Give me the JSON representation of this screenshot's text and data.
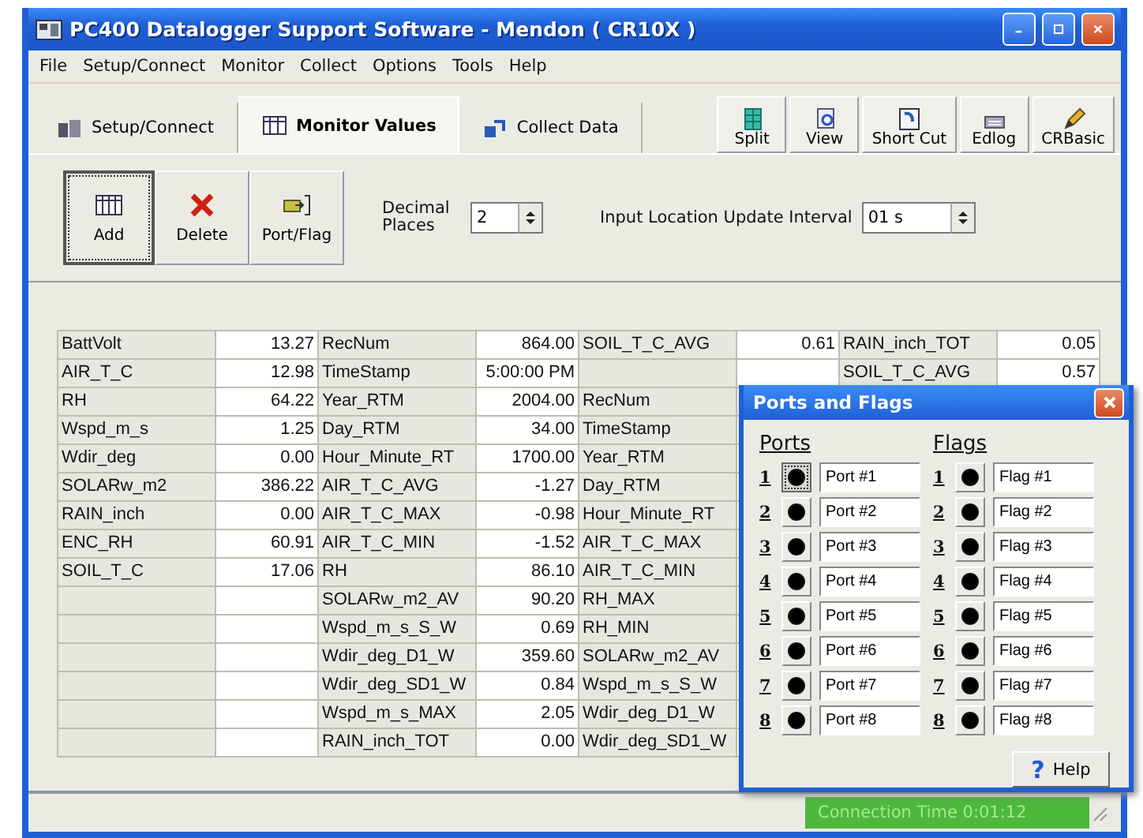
{
  "window": {
    "title": "PC400 Datalogger Support Software - Mendon ( CR10X )"
  },
  "menu": [
    {
      "label": "File"
    },
    {
      "label": "Setup/Connect"
    },
    {
      "label": "Monitor"
    },
    {
      "label": "Collect"
    },
    {
      "label": "Options"
    },
    {
      "label": "Tools"
    },
    {
      "label": "Help"
    }
  ],
  "tabs": [
    {
      "label": "Setup/Connect",
      "selected": false
    },
    {
      "label": "Monitor Values",
      "selected": true
    },
    {
      "label": "Collect Data",
      "selected": false
    }
  ],
  "tools": [
    {
      "label": "Split"
    },
    {
      "label": "View"
    },
    {
      "label": "Short Cut"
    },
    {
      "label": "Edlog"
    },
    {
      "label": "CRBasic"
    }
  ],
  "toolbar": {
    "buttons": [
      {
        "label": "Add",
        "selected": true
      },
      {
        "label": "Delete",
        "selected": false
      },
      {
        "label": "Port/Flag",
        "selected": false
      }
    ],
    "decimal_label": "Decimal Places",
    "decimal_value": "2",
    "interval_label": "Input Location Update Interval",
    "interval_value": "01 s"
  },
  "table": {
    "rows": [
      {
        "pairs": [
          {
            "name": "BattVolt",
            "value": "13.27"
          },
          {
            "name": "RecNum",
            "value": "864.00"
          },
          {
            "name": "SOIL_T_C_AVG",
            "value": "0.61"
          },
          {
            "name": "RAIN_inch_TOT",
            "value": "0.05"
          }
        ]
      },
      {
        "pairs": [
          {
            "name": "AIR_T_C",
            "value": "12.98"
          },
          {
            "name": "TimeStamp",
            "value": "5:00:00 PM"
          },
          {
            "blank": true
          },
          {
            "name": "SOIL_T_C_AVG",
            "value": "0.57"
          }
        ]
      },
      {
        "pairs": [
          {
            "name": "RH",
            "value": "64.22"
          },
          {
            "name": "Year_RTM",
            "value": "2004.00"
          },
          {
            "name": "RecNum"
          }
        ]
      },
      {
        "pairs": [
          {
            "name": "Wspd_m_s",
            "value": "1.25"
          },
          {
            "name": "Day_RTM",
            "value": "34.00"
          },
          {
            "name": "TimeStamp"
          }
        ]
      },
      {
        "pairs": [
          {
            "name": "Wdir_deg",
            "value": "0.00"
          },
          {
            "name": "Hour_Minute_RT",
            "value": "1700.00"
          },
          {
            "name": "Year_RTM"
          }
        ]
      },
      {
        "pairs": [
          {
            "name": "SOLARw_m2",
            "value": "386.22"
          },
          {
            "name": "AIR_T_C_AVG",
            "value": "-1.27"
          },
          {
            "name": "Day_RTM"
          }
        ]
      },
      {
        "pairs": [
          {
            "name": "RAIN_inch",
            "value": "0.00"
          },
          {
            "name": "AIR_T_C_MAX",
            "value": "-0.98"
          },
          {
            "name": "Hour_Minute_RT"
          }
        ]
      },
      {
        "pairs": [
          {
            "name": "ENC_RH",
            "value": "60.91"
          },
          {
            "name": "AIR_T_C_MIN",
            "value": "-1.52"
          },
          {
            "name": "AIR_T_C_MAX"
          }
        ]
      },
      {
        "pairs": [
          {
            "name": "SOIL_T_C",
            "value": "17.06"
          },
          {
            "name": "RH",
            "value": "86.10"
          },
          {
            "name": "AIR_T_C_MIN"
          }
        ]
      },
      {
        "pairs": [
          {
            "blank": true
          },
          {
            "name": "SOLARw_m2_AV",
            "value": "90.20"
          },
          {
            "name": "RH_MAX"
          }
        ]
      },
      {
        "pairs": [
          {
            "blank": true
          },
          {
            "name": "Wspd_m_s_S_W",
            "value": "0.69"
          },
          {
            "name": "RH_MIN"
          }
        ]
      },
      {
        "pairs": [
          {
            "blank": true
          },
          {
            "name": "Wdir_deg_D1_W",
            "value": "359.60"
          },
          {
            "name": "SOLARw_m2_AV"
          }
        ]
      },
      {
        "pairs": [
          {
            "blank": true
          },
          {
            "name": "Wdir_deg_SD1_W",
            "value": "0.84"
          },
          {
            "name": "Wspd_m_s_S_W"
          }
        ]
      },
      {
        "pairs": [
          {
            "blank": true
          },
          {
            "name": "Wspd_m_s_MAX",
            "value": "2.05"
          },
          {
            "name": "Wdir_deg_D1_W"
          }
        ]
      },
      {
        "pairs": [
          {
            "blank": true
          },
          {
            "name": "RAIN_inch_TOT",
            "value": "0.00"
          },
          {
            "name": "Wdir_deg_SD1_W"
          }
        ]
      }
    ]
  },
  "dialog": {
    "title": "Ports and Flags",
    "ports_heading": "Ports",
    "flags_heading": "Flags",
    "ports": [
      {
        "number": "1",
        "selected": true,
        "label": "Port #1"
      },
      {
        "number": "2",
        "selected": false,
        "label": "Port #2"
      },
      {
        "number": "3",
        "selected": false,
        "label": "Port #3"
      },
      {
        "number": "4",
        "selected": false,
        "label": "Port #4"
      },
      {
        "number": "5",
        "selected": false,
        "label": "Port #5"
      },
      {
        "number": "6",
        "selected": false,
        "label": "Port #6"
      },
      {
        "number": "7",
        "selected": false,
        "label": "Port #7"
      },
      {
        "number": "8",
        "selected": false,
        "label": "Port #8"
      }
    ],
    "flags": [
      {
        "number": "1",
        "selected": false,
        "label": "Flag #1"
      },
      {
        "number": "2",
        "selected": false,
        "label": "Flag #2"
      },
      {
        "number": "3",
        "selected": false,
        "label": "Flag #3"
      },
      {
        "number": "4",
        "selected": false,
        "label": "Flag #4"
      },
      {
        "number": "5",
        "selected": false,
        "label": "Flag #5"
      },
      {
        "number": "6",
        "selected": false,
        "label": "Flag #6"
      },
      {
        "number": "7",
        "selected": false,
        "label": "Flag #7"
      },
      {
        "number": "8",
        "selected": false,
        "label": "Flag #8"
      }
    ],
    "help": {
      "icon": "?",
      "label": "Help"
    }
  },
  "status_bar": {
    "connection": "Connection Time 0:01:12"
  }
}
